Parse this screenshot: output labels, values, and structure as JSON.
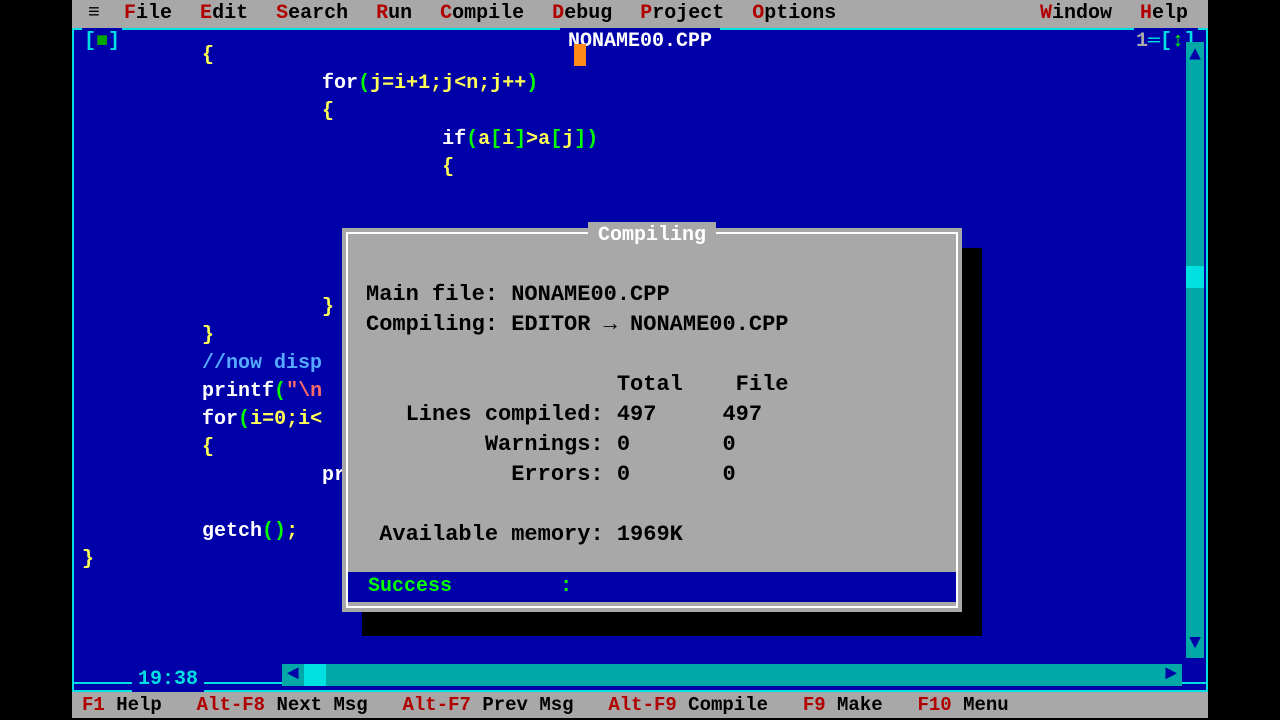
{
  "menu": {
    "sys_icon": "≡",
    "items": [
      {
        "hot": "F",
        "rest": "ile"
      },
      {
        "hot": "E",
        "rest": "dit"
      },
      {
        "hot": "S",
        "rest": "earch"
      },
      {
        "hot": "R",
        "rest": "un"
      },
      {
        "hot": "C",
        "rest": "ompile"
      },
      {
        "hot": "D",
        "rest": "ebug"
      },
      {
        "hot": "P",
        "rest": "roject"
      },
      {
        "hot": "O",
        "rest": "ptions"
      }
    ],
    "right_items": [
      {
        "hot": "W",
        "rest": "indow"
      },
      {
        "hot": "H",
        "rest": "elp"
      }
    ]
  },
  "window": {
    "title": "NONAME00.CPP",
    "window_number_label": "1",
    "close_glyph_l": "[",
    "close_glyph_r": "]",
    "close_inner": "■",
    "max_inner": "↕",
    "cursor_position": "19:38",
    "scroll_up": "▲",
    "scroll_down": "▼",
    "scroll_left": "◄",
    "scroll_right": "►"
  },
  "code_lines": [
    {
      "indent": "          ",
      "segs": [
        {
          "t": "{",
          "c": "sym"
        }
      ]
    },
    {
      "indent": "                    ",
      "segs": [
        {
          "t": "for",
          "c": "kw"
        },
        {
          "t": "(",
          "c": "pn"
        },
        {
          "t": "j",
          "c": "sym"
        },
        {
          "t": "=",
          "c": "sym"
        },
        {
          "t": "i",
          "c": "sym"
        },
        {
          "t": "+",
          "c": "sym"
        },
        {
          "t": "1",
          "c": "sym"
        },
        {
          "t": ";",
          "c": "sym"
        },
        {
          "t": "j",
          "c": "sym"
        },
        {
          "t": "<",
          "c": "sym"
        },
        {
          "t": "n",
          "c": "sym"
        },
        {
          "t": ";",
          "c": "sym"
        },
        {
          "t": "j",
          "c": "sym"
        },
        {
          "t": "++",
          "c": "sym"
        },
        {
          "t": ")",
          "c": "pn"
        }
      ]
    },
    {
      "indent": "                    ",
      "segs": [
        {
          "t": "{",
          "c": "sym"
        }
      ]
    },
    {
      "indent": "                              ",
      "segs": [
        {
          "t": "if",
          "c": "kw"
        },
        {
          "t": "(",
          "c": "pn"
        },
        {
          "t": "a",
          "c": "sym"
        },
        {
          "t": "[",
          "c": "pn"
        },
        {
          "t": "i",
          "c": "sym"
        },
        {
          "t": "]",
          "c": "pn"
        },
        {
          "t": ">",
          "c": "sym"
        },
        {
          "t": "a",
          "c": "sym"
        },
        {
          "t": "[",
          "c": "pn"
        },
        {
          "t": "j",
          "c": "sym"
        },
        {
          "t": "]",
          "c": "pn"
        },
        {
          "t": ")",
          "c": "pn"
        }
      ]
    },
    {
      "indent": "                              ",
      "segs": [
        {
          "t": "{",
          "c": "sym"
        }
      ]
    },
    {
      "indent": "",
      "segs": []
    },
    {
      "indent": "",
      "segs": []
    },
    {
      "indent": "",
      "segs": []
    },
    {
      "indent": "",
      "segs": []
    },
    {
      "indent": "                    ",
      "segs": [
        {
          "t": "}",
          "c": "sym"
        }
      ]
    },
    {
      "indent": "          ",
      "segs": [
        {
          "t": "}",
          "c": "sym"
        }
      ]
    },
    {
      "indent": "          ",
      "segs": [
        {
          "t": "//now disp",
          "c": "cm"
        }
      ]
    },
    {
      "indent": "          ",
      "segs": [
        {
          "t": "printf",
          "c": "kw"
        },
        {
          "t": "(",
          "c": "pn"
        },
        {
          "t": "\"\\n",
          "c": "str"
        }
      ]
    },
    {
      "indent": "          ",
      "segs": [
        {
          "t": "for",
          "c": "kw"
        },
        {
          "t": "(",
          "c": "pn"
        },
        {
          "t": "i",
          "c": "sym"
        },
        {
          "t": "=",
          "c": "sym"
        },
        {
          "t": "0",
          "c": "sym"
        },
        {
          "t": ";",
          "c": "sym"
        },
        {
          "t": "i",
          "c": "sym"
        },
        {
          "t": "<",
          "c": "sym"
        }
      ]
    },
    {
      "indent": "          ",
      "segs": [
        {
          "t": "{",
          "c": "sym"
        }
      ]
    },
    {
      "indent": "                    ",
      "segs": [
        {
          "t": "pr",
          "c": "kw"
        }
      ]
    },
    {
      "indent": "",
      "segs": []
    },
    {
      "indent": "          ",
      "segs": [
        {
          "t": "getch",
          "c": "kw"
        },
        {
          "t": "()",
          "c": "pn"
        },
        {
          "t": ";",
          "c": "sym"
        }
      ]
    },
    {
      "indent": "",
      "segs": [
        {
          "t": "}",
          "c": "sym"
        }
      ]
    }
  ],
  "dialog": {
    "title": "Compiling",
    "main_file_label": "Main file:",
    "main_file_value": "NONAME00.CPP",
    "compiling_label": "Compiling:",
    "compiling_value": "EDITOR → NONAME00.CPP",
    "col_total": "Total",
    "col_file": "File",
    "rows": [
      {
        "label": "Lines compiled:",
        "total": "497",
        "file": "497"
      },
      {
        "label": "Warnings:",
        "total": "0",
        "file": "0"
      },
      {
        "label": "Errors:",
        "total": "0",
        "file": "0"
      }
    ],
    "mem_label": "Available memory:",
    "mem_value": "1969K",
    "status_label": "Success",
    "status_sep": ":"
  },
  "funcbar": [
    {
      "hot": "F1",
      "label": " Help"
    },
    {
      "hot": "Alt-F8",
      "label": " Next Msg"
    },
    {
      "hot": "Alt-F7",
      "label": " Prev Msg"
    },
    {
      "hot": "Alt-F9",
      "label": " Compile"
    },
    {
      "hot": "F9",
      "label": " Make"
    },
    {
      "hot": "F10",
      "label": " Menu"
    }
  ]
}
